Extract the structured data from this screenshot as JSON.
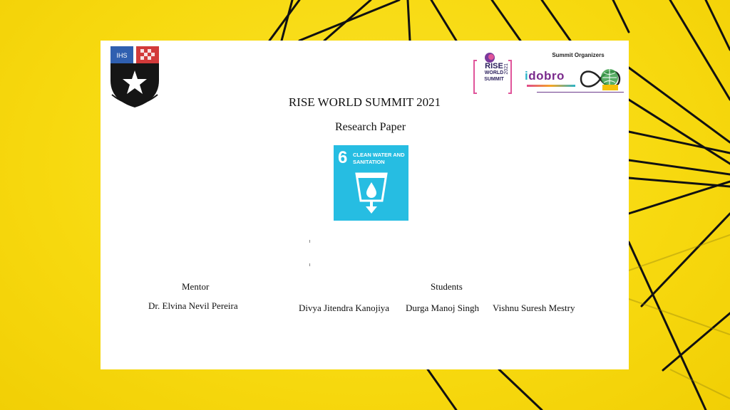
{
  "header": {
    "organizers_label": "Summit Organizers",
    "rise_logo": {
      "word1": "RISE",
      "word2": "WORLD",
      "word3": "SUMMIT",
      "year": "2021"
    },
    "idobro_logo": {
      "prefix": "i",
      "word": "dobro"
    },
    "crest_icon": "school-crest-icon",
    "rise_globe_icon": "rise-globe-icon"
  },
  "document": {
    "title": "RISE WORLD SUMMIT 2021",
    "subtitle": "Research Paper"
  },
  "sdg_tile": {
    "number": "6",
    "label": "CLEAN WATER AND SANITATION",
    "color": "#26bde2",
    "icon": "water-glass-icon"
  },
  "mentor": {
    "heading": "Mentor",
    "name": "Dr. Elvina Nevil Pereira"
  },
  "students": {
    "heading": "Students",
    "names": [
      "Divya Jitendra Kanojiya",
      "Durga Manoj Singh",
      "Vishnu Suresh Mestry"
    ]
  },
  "colors": {
    "background": "#f7d90f",
    "lines": "#111111",
    "page": "#ffffff"
  }
}
